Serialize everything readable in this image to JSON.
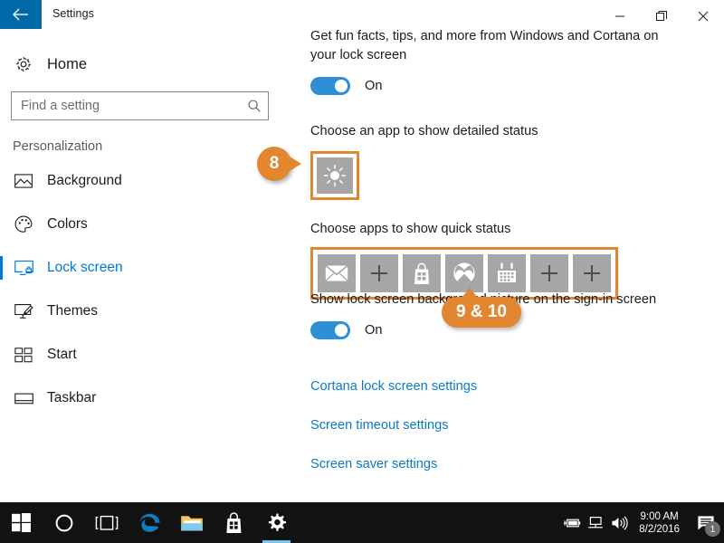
{
  "window": {
    "title": "Settings",
    "back_icon": "back-arrow-icon",
    "minimize_icon": "minimize-icon",
    "restore_icon": "restore-icon",
    "close_icon": "close-icon",
    "titlebar_accent": "#0069a8"
  },
  "sidebar": {
    "home_label": "Home",
    "home_icon": "gear-icon",
    "search": {
      "placeholder": "Find a setting",
      "value": "",
      "icon": "search-icon"
    },
    "category": "Personalization",
    "items": [
      {
        "label": "Background",
        "icon": "picture-icon",
        "selected": false
      },
      {
        "label": "Colors",
        "icon": "palette-icon",
        "selected": false
      },
      {
        "label": "Lock screen",
        "icon": "lock-screen-icon",
        "selected": true
      },
      {
        "label": "Themes",
        "icon": "brush-monitor-icon",
        "selected": false
      },
      {
        "label": "Start",
        "icon": "start-tiles-icon",
        "selected": false
      },
      {
        "label": "Taskbar",
        "icon": "taskbar-icon",
        "selected": false
      }
    ],
    "selected_color": "#0078d7"
  },
  "main": {
    "cortana_tips": {
      "text": "Get fun facts, tips, and more from Windows and Cortana on your lock screen",
      "toggle_state": "On"
    },
    "detailed_status": {
      "heading": "Choose an app to show detailed status",
      "tile_icon": "weather-sun-icon"
    },
    "quick_status": {
      "heading": "Choose apps to show quick status",
      "tiles": [
        {
          "icon": "mail-icon"
        },
        {
          "icon": "plus-icon"
        },
        {
          "icon": "store-icon"
        },
        {
          "icon": "xbox-icon"
        },
        {
          "icon": "calendar-icon"
        },
        {
          "icon": "plus-icon"
        },
        {
          "icon": "plus-icon"
        }
      ]
    },
    "signin_background": {
      "text": "Show lock screen background picture on the sign-in screen",
      "toggle_state": "On"
    },
    "links": [
      "Cortana lock screen settings",
      "Screen timeout settings",
      "Screen saver settings"
    ],
    "link_color": "#0b7ac8"
  },
  "callouts": {
    "accent_color": "#e2872f",
    "badge_8": "8",
    "badge_9_10": "9 & 10"
  },
  "taskbar": {
    "items": [
      {
        "icon": "windows-start-icon",
        "active": false
      },
      {
        "icon": "cortana-circle-icon",
        "active": false
      },
      {
        "icon": "task-view-icon",
        "active": false
      },
      {
        "icon": "edge-browser-icon",
        "active": false
      },
      {
        "icon": "file-explorer-icon",
        "active": false
      },
      {
        "icon": "store-icon",
        "active": false
      },
      {
        "icon": "settings-gear-icon",
        "active": true
      }
    ],
    "tray": {
      "power_icon": "battery-charging-icon",
      "network_icon": "network-icon",
      "volume_icon": "volume-icon",
      "time": "9:00 AM",
      "date": "8/2/2016",
      "notification_icon": "action-center-icon",
      "notification_count": "1"
    }
  }
}
